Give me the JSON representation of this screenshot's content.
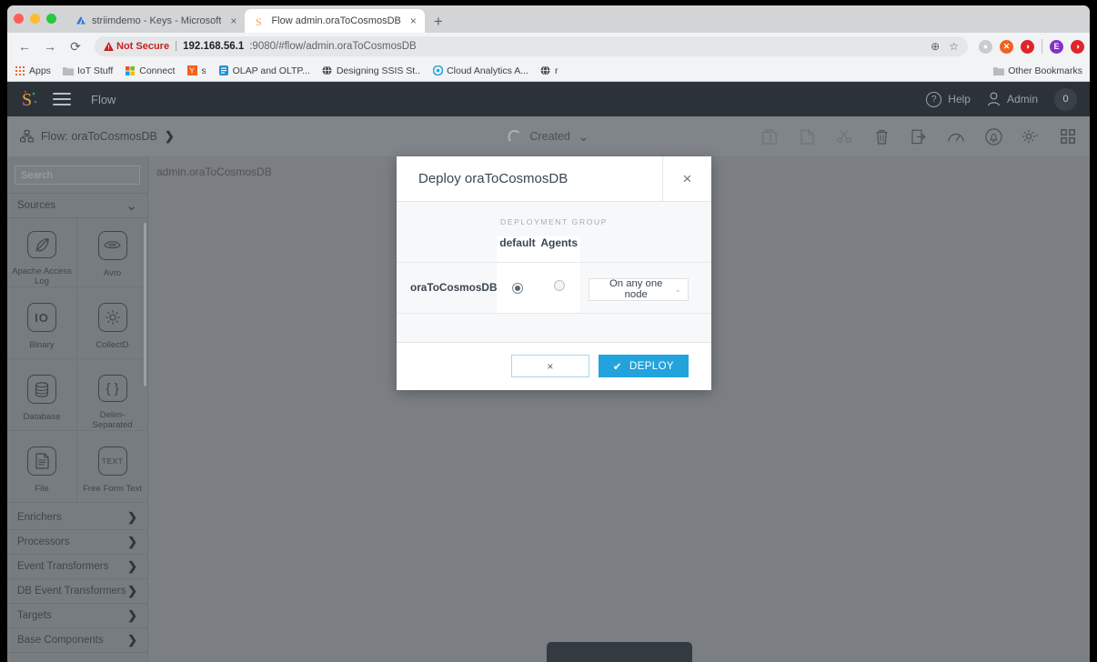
{
  "browser": {
    "tabs": [
      {
        "label": "striimdemo - Keys - Microsoft",
        "favicon": "azure-icon",
        "active": false,
        "close": "×"
      },
      {
        "label": "Flow admin.oraToCosmosDB",
        "favicon": "striim-icon",
        "active": true,
        "close": "×"
      }
    ],
    "new_tab": "+",
    "nav": {
      "back": "←",
      "forward": "→",
      "reload": "⟳"
    },
    "omnibox": {
      "warning_icon": "warning-triangle-icon",
      "not_secure": "Not Secure",
      "separator": "|",
      "url_host": "192.168.56.1",
      "url_rest": ":9080/#flow/admin.oraToCosmosDB",
      "zoom_icon": "⊕",
      "star_icon": "☆"
    },
    "extensions": [
      {
        "name": "profile-globe-icon",
        "glyph": "◌",
        "color": "#9aa0a6"
      },
      {
        "name": "extension-orange-icon",
        "glyph": "✕",
        "color": "#f4601f"
      },
      {
        "name": "extension-red-icon",
        "glyph": "◑",
        "color": "#e0252a"
      },
      {
        "name": "profile-avatar",
        "glyph": "E",
        "color": "#8430ce"
      },
      {
        "name": "extension-red2-icon",
        "glyph": "◑",
        "color": "#e0252a"
      }
    ],
    "bookmarks": [
      {
        "label": "Apps",
        "icon": "apps-grid-icon"
      },
      {
        "label": "IoT Stuff",
        "icon": "folder-icon"
      },
      {
        "label": "Connect",
        "icon": "microsoft-icon"
      },
      {
        "label": "s",
        "icon": "yammer-icon"
      },
      {
        "label": "OLAP and OLTP...",
        "icon": "blue-doc-icon"
      },
      {
        "label": "Designing SSIS St..",
        "icon": "globe-icon"
      },
      {
        "label": "Cloud Analytics A...",
        "icon": "circle-blue-icon"
      },
      {
        "label": "r",
        "icon": "globe-icon"
      }
    ],
    "other_bookmarks": {
      "label": "Other Bookmarks",
      "icon": "folder-icon"
    }
  },
  "app": {
    "header": {
      "logo": "striim-logo",
      "menu_icon": "hamburger-menu-icon",
      "title": "Flow",
      "help": {
        "label": "Help",
        "icon": "question-circle-icon"
      },
      "user": {
        "label": "Admin",
        "icon": "user-icon"
      },
      "badge": "0"
    },
    "flowbar": {
      "crumb_icon": "flow-nodes-icon",
      "crumb": "Flow: oraToCosmosDB",
      "crumb_chevron": "❯",
      "status": "Created",
      "status_caret": "⌄",
      "tools": [
        {
          "name": "copy-icon",
          "dim": true
        },
        {
          "name": "paste-icon",
          "dim": true
        },
        {
          "name": "cut-icon",
          "dim": true
        },
        {
          "name": "delete-trash-icon",
          "dim": false
        },
        {
          "name": "export-icon",
          "dim": false
        },
        {
          "name": "monitor-gauge-icon",
          "dim": false
        },
        {
          "name": "alerts-bell-icon",
          "dim": false
        },
        {
          "name": "settings-gear-icon",
          "dim": false
        },
        {
          "name": "grid-view-icon",
          "dim": false
        }
      ]
    },
    "sidebar": {
      "search_placeholder": "Search",
      "sections": [
        {
          "label": "Sources",
          "expanded": true,
          "caret": "⌄"
        }
      ],
      "palette": [
        {
          "label": "Apache Access Log",
          "icon": "feather-quill-icon"
        },
        {
          "label": "Avro",
          "icon": "avro-icon"
        },
        {
          "label": "Binary",
          "icon": "binary-io-icon"
        },
        {
          "label": "CollectD",
          "icon": "collectd-icon"
        },
        {
          "label": "Database",
          "icon": "database-icon"
        },
        {
          "label": "Delim-Separated",
          "icon": "braces-icon"
        },
        {
          "label": "File",
          "icon": "file-doc-icon"
        },
        {
          "label": "Free Form Text",
          "icon": "text-icon"
        }
      ],
      "collapsed_sections": [
        {
          "label": "Enrichers",
          "caret": "❯"
        },
        {
          "label": "Processors",
          "caret": "❯"
        },
        {
          "label": "Event Transformers",
          "caret": "❯"
        },
        {
          "label": "DB Event Transformers",
          "caret": "❯"
        },
        {
          "label": "Targets",
          "caret": "❯"
        },
        {
          "label": "Base Components",
          "caret": "❯"
        }
      ]
    },
    "canvas": {
      "label": "admin.oraToCosmosDB"
    }
  },
  "modal": {
    "title": "Deploy oraToCosmosDB",
    "close": "×",
    "group_label": "DEPLOYMENT GROUP",
    "columns": [
      "default",
      "Agents"
    ],
    "rows": [
      {
        "name": "oraToCosmosDB",
        "default_selected": true,
        "agents_selected": false,
        "node_option": "On any one node",
        "caret": "⌄"
      }
    ],
    "cancel_label": "×",
    "deploy_label": "DEPLOY",
    "deploy_check": "✔",
    "accent_color": "#23a3dc"
  }
}
